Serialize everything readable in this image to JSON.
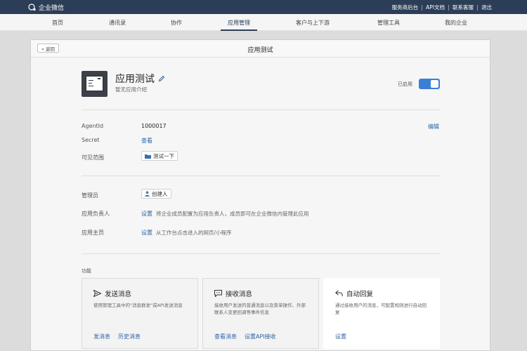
{
  "topbar": {
    "brand": "企业微信",
    "links": [
      "服务商后台",
      "API文档",
      "联系客服",
      "退出"
    ]
  },
  "nav": {
    "items": [
      "首页",
      "通讯录",
      "协作",
      "应用管理",
      "客户与上下游",
      "管理工具",
      "我的企业"
    ],
    "active": "应用管理"
  },
  "panel": {
    "back_label": "« 返回",
    "title": "应用测试"
  },
  "app": {
    "name": "应用测试",
    "description": "暂无应用介绍",
    "enabled_label": "已启用",
    "enabled": true
  },
  "details": {
    "agentid_label": "AgentId",
    "agentid_value": "1000017",
    "secret_label": "Secret",
    "secret_action": "查看",
    "visible_label": "可见范围",
    "visible_value": "测试一下",
    "edit_label": "编辑"
  },
  "admin": {
    "manager_label": "管理员",
    "manager_value": "创建人",
    "owner_label": "应用负责人",
    "owner_action": "设置",
    "owner_desc": "将企业成员配置为应用负责人，成员即可在企业微信内管理此应用",
    "homepage_label": "应用主页",
    "homepage_action": "设置",
    "homepage_desc": "从工作台点击进入的网页/小程序"
  },
  "features": {
    "section_label": "功能",
    "cards": [
      {
        "title": "发送消息",
        "desc": "使用管理工具中的\"消息群发\"或API发送消息",
        "links": [
          "发消息",
          "历史消息"
        ]
      },
      {
        "title": "接收消息",
        "desc": "接收用户发送的普通消息以及菜单操作、外部联系人变更回调等事件信息",
        "links": [
          "查看消息",
          "设置API接收"
        ]
      },
      {
        "title": "自动回复",
        "desc": "通过接收用户的消息，可配置规则进行自动回复",
        "links": [
          "设置"
        ]
      }
    ]
  },
  "colors": {
    "topbar": "#2c3e57",
    "accent": "#3a7fd6",
    "link": "#2b63a8"
  }
}
